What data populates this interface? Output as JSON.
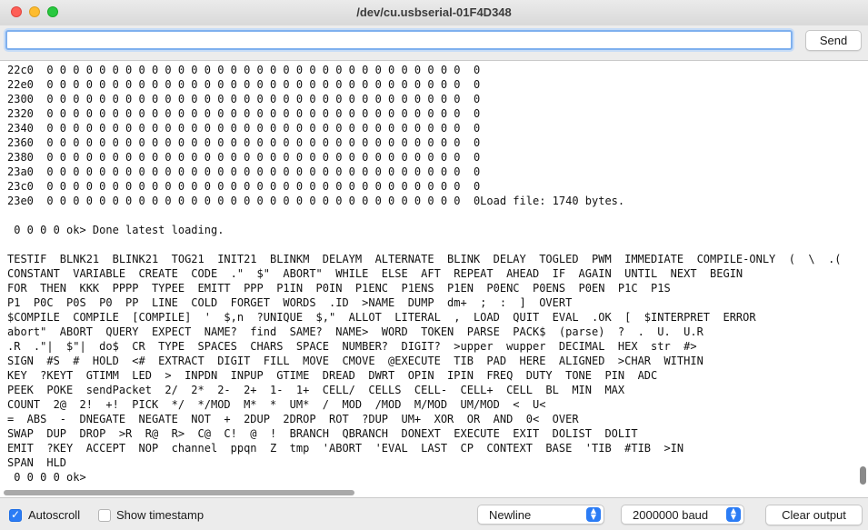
{
  "window": {
    "title": "/dev/cu.usbserial-01F4D348"
  },
  "send": {
    "input_value": "",
    "button_label": "Send"
  },
  "output": {
    "lines": [
      "22c0  0 0 0 0 0 0 0 0 0 0 0 0 0 0 0 0 0 0 0 0 0 0 0 0 0 0 0 0 0 0 0 0  0",
      "22e0  0 0 0 0 0 0 0 0 0 0 0 0 0 0 0 0 0 0 0 0 0 0 0 0 0 0 0 0 0 0 0 0  0",
      "2300  0 0 0 0 0 0 0 0 0 0 0 0 0 0 0 0 0 0 0 0 0 0 0 0 0 0 0 0 0 0 0 0  0",
      "2320  0 0 0 0 0 0 0 0 0 0 0 0 0 0 0 0 0 0 0 0 0 0 0 0 0 0 0 0 0 0 0 0  0",
      "2340  0 0 0 0 0 0 0 0 0 0 0 0 0 0 0 0 0 0 0 0 0 0 0 0 0 0 0 0 0 0 0 0  0",
      "2360  0 0 0 0 0 0 0 0 0 0 0 0 0 0 0 0 0 0 0 0 0 0 0 0 0 0 0 0 0 0 0 0  0",
      "2380  0 0 0 0 0 0 0 0 0 0 0 0 0 0 0 0 0 0 0 0 0 0 0 0 0 0 0 0 0 0 0 0  0",
      "23a0  0 0 0 0 0 0 0 0 0 0 0 0 0 0 0 0 0 0 0 0 0 0 0 0 0 0 0 0 0 0 0 0  0",
      "23c0  0 0 0 0 0 0 0 0 0 0 0 0 0 0 0 0 0 0 0 0 0 0 0 0 0 0 0 0 0 0 0 0  0",
      "23e0  0 0 0 0 0 0 0 0 0 0 0 0 0 0 0 0 0 0 0 0 0 0 0 0 0 0 0 0 0 0 0 0  0Load file: 1740 bytes.",
      "",
      " 0 0 0 0 ok> Done latest loading.",
      "",
      "TESTIF  BLNK21  BLINK21  TOG21  INIT21  BLINKM  DELAYM  ALTERNATE  BLINK  DELAY  TOGLED  PWM  IMMEDIATE  COMPILE-ONLY  (  \\  .(",
      "CONSTANT  VARIABLE  CREATE  CODE  .\"  $\"  ABORT\"  WHILE  ELSE  AFT  REPEAT  AHEAD  IF  AGAIN  UNTIL  NEXT  BEGIN",
      "FOR  THEN  KKK  PPPP  TYPEE  EMITT  PPP  P1IN  P0IN  P1ENC  P1ENS  P1EN  P0ENC  P0ENS  P0EN  P1C  P1S",
      "P1  P0C  P0S  P0  PP  LINE  COLD  FORGET  WORDS  .ID  >NAME  DUMP  dm+  ;  :  ]  OVERT",
      "$COMPILE  COMPILE  [COMPILE]  '  $,n  ?UNIQUE  $,\"  ALLOT  LITERAL  ,  LOAD  QUIT  EVAL  .OK  [  $INTERPRET  ERROR",
      "abort\"  ABORT  QUERY  EXPECT  NAME?  find  SAME?  NAME>  WORD  TOKEN  PARSE  PACK$  (parse)  ?  .  U.  U.R",
      ".R  .\"|  $\"|  do$  CR  TYPE  SPACES  CHARS  SPACE  NUMBER?  DIGIT?  >upper  wupper  DECIMAL  HEX  str  #>",
      "SIGN  #S  #  HOLD  <#  EXTRACT  DIGIT  FILL  MOVE  CMOVE  @EXECUTE  TIB  PAD  HERE  ALIGNED  >CHAR  WITHIN",
      "KEY  ?KEYT  GTIMM  LED  >  INPDN  INPUP  GTIME  DREAD  DWRT  OPIN  IPIN  FREQ  DUTY  TONE  PIN  ADC",
      "PEEK  POKE  sendPacket  2/  2*  2-  2+  1-  1+  CELL/  CELLS  CELL-  CELL+  CELL  BL  MIN  MAX",
      "COUNT  2@  2!  +!  PICK  */  */MOD  M*  *  UM*  /  MOD  /MOD  M/MOD  UM/MOD  <  U<",
      "=  ABS  -  DNEGATE  NEGATE  NOT  +  2DUP  2DROP  ROT  ?DUP  UM+  XOR  OR  AND  0<  OVER",
      "SWAP  DUP  DROP  >R  R@  R>  C@  C!  @  !  BRANCH  QBRANCH  DONEXT  EXECUTE  EXIT  DOLIST  DOLIT",
      "EMIT  ?KEY  ACCEPT  NOP  channel  ppqn  Z  tmp  'ABORT  'EVAL  LAST  CP  CONTEXT  BASE  'TIB  #TIB  >IN",
      "SPAN  HLD",
      " 0 0 0 0 ok>"
    ]
  },
  "footer": {
    "autoscroll": {
      "label": "Autoscroll",
      "checked": true
    },
    "timestamp": {
      "label": "Show timestamp",
      "checked": false
    },
    "line_ending": "Newline",
    "baud": "2000000 baud",
    "clear_label": "Clear output"
  },
  "colors": {
    "accent": "#2b7cf5",
    "focus_ring": "#7fb0ee"
  }
}
